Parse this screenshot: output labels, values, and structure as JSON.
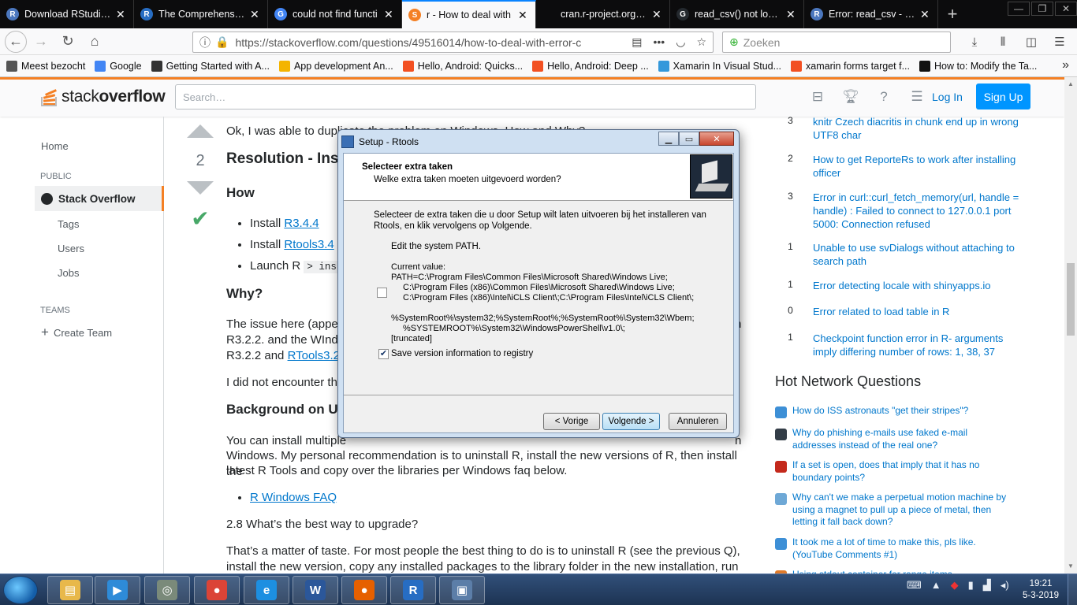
{
  "browser": {
    "tabs": [
      {
        "label": "Download RStudio -",
        "fav_color": "#4b77be",
        "fav_letter": "R"
      },
      {
        "label": "The Comprehensive",
        "fav_color": "#276dc3",
        "fav_letter": "R"
      },
      {
        "label": "could not find functi",
        "fav_color": "#4285f4",
        "fav_letter": "G"
      },
      {
        "label": "r - How to deal with",
        "fav_color": "#f48024",
        "fav_letter": "S"
      },
      {
        "label": "cran.r-project.org/bin/w",
        "fav_color": "",
        "fav_letter": ""
      },
      {
        "label": "read_csv() not loadin",
        "fav_color": "#24292e",
        "fav_letter": "G"
      },
      {
        "label": "Error: read_csv - RSt",
        "fav_color": "#4b77be",
        "fav_letter": "R"
      }
    ],
    "url": "https://stackoverflow.com/questions/49516014/how-to-deal-with-error-c",
    "search_placeholder": "Zoeken",
    "bookmarks": [
      {
        "label": "Meest bezocht",
        "icon": "gear-icon",
        "color": "#555"
      },
      {
        "label": "Google",
        "icon": "google-icon",
        "color": "#4285f4"
      },
      {
        "label": "Getting Started with A...",
        "icon": "cd-icon",
        "color": "#333"
      },
      {
        "label": "App development An...",
        "icon": "android-icon",
        "color": "#f4b400"
      },
      {
        "label": "Hello, Android: Quicks...",
        "icon": "microsoft-icon",
        "color": "#f25022"
      },
      {
        "label": "Hello, Android: Deep ...",
        "icon": "microsoft-icon",
        "color": "#f25022"
      },
      {
        "label": "Xamarin In Visual Stud...",
        "icon": "xamarin-icon",
        "color": "#3498db"
      },
      {
        "label": "xamarin forms target f...",
        "icon": "microsoft-icon",
        "color": "#f25022"
      },
      {
        "label": "How to: Modify the Ta...",
        "icon": "m-icon",
        "color": "#111"
      }
    ]
  },
  "so": {
    "logo_a": "stack",
    "logo_b": "overflow",
    "search_placeholder": "Search…",
    "login": "Log In",
    "signup": "Sign Up",
    "nav": {
      "home": "Home",
      "public": "PUBLIC",
      "stackoverflow": "Stack Overflow",
      "tags": "Tags",
      "users": "Users",
      "jobs": "Jobs",
      "teams": "TEAMS",
      "create_team": "Create Team"
    }
  },
  "answer": {
    "score": "2",
    "intro": "Ok, I was able to duplicate the problem on Windows. How and Why?",
    "resolution_heading": "Resolution - Ins",
    "how_heading": "How",
    "install_prefix_1": "Install ",
    "install_link_1": "R3.4.4",
    "install_prefix_2": "Install ",
    "install_link_2": "Rtools3.4",
    "launch": "Launch R ",
    "launch_code": "> ins",
    "why_heading": "Why?",
    "issue_text_1": "The issue here (appe",
    "issue_text_1b": "n",
    "issue_text_2": "R3.2.2. and the WInd",
    "issue_text_3a": "R3.2.2 and ",
    "issue_link_3": "RTools3.2",
    "encounter": "I did not encounter the",
    "background_heading": "Background on U",
    "install_multiple_a": "You can install multiple",
    "install_multiple_b": "n",
    "install_multiple_2": "Windows. My personal recommendation is to uninstall R, install the new versions of R, then install the",
    "install_multiple_3": "latest R Tools and copy over the libraries per Windows faq below.",
    "faq_link": "R Windows FAQ",
    "upgrade": "2.8 What’s the best way to upgrade?",
    "taste_1": "That’s a matter of taste. For most people the best thing to do is to uninstall R (see the previous Q),",
    "taste_2": "install the new version, copy any installed packages to the library folder in the new installation, run"
  },
  "related": [
    {
      "count": "3",
      "title": "knitr Czech diacritis in chunk end up in wrong UTF8 char"
    },
    {
      "count": "2",
      "title": "How to get ReporteRs to work after installing officer"
    },
    {
      "count": "3",
      "title": "Error in curl::curl_fetch_memory(url, handle = handle) : Failed to connect to 127.0.0.1 port 5000: Connection refused"
    },
    {
      "count": "1",
      "title": "Unable to use svDialogs without attaching to search path"
    },
    {
      "count": "1",
      "title": "Error detecting locale with shinyapps.io"
    },
    {
      "count": "0",
      "title": "Error related to load table in R"
    },
    {
      "count": "1",
      "title": "Checkpoint function error in R- arguments imply differing number of rows: 1, 38, 37"
    }
  ],
  "hnq": {
    "title": "Hot Network Questions",
    "items": [
      {
        "title": "How do ISS astronauts \"get their stripes\"?",
        "color": "#3d8fd6",
        "icon": "space-icon"
      },
      {
        "title": "Why do phishing e-mails use faked e-mail addresses instead of the real one?",
        "color": "#333d47",
        "icon": "security-icon"
      },
      {
        "title": "If a set is open, does that imply that it has no boundary points?",
        "color": "#c4291c",
        "icon": "math-icon"
      },
      {
        "title": "Why can't we make a perpetual motion machine by using a magnet to pull up a piece of metal, then letting it fall back down?",
        "color": "#6ea8d6",
        "icon": "physics-icon"
      },
      {
        "title": "It took me a lot of time to make this, pls like. (YouTube Comments #1)",
        "color": "#3d8fd6",
        "icon": "puzzling-icon"
      },
      {
        "title": "Using stdout container for range items",
        "color": "#e07b2a",
        "icon": "code-icon"
      }
    ]
  },
  "dialog": {
    "title": "Setup - Rtools",
    "heading": "Selecteer extra taken",
    "subheading": "Welke extra taken moeten uitgevoerd worden?",
    "instructions_1": "Selecteer de extra taken die u door Setup wilt laten uitvoeren bij het installeren van",
    "instructions_2": "Rtools, en klik vervolgens op Volgende.",
    "edit_path": "Edit the system PATH.",
    "current_value": "Current value:",
    "path_1": "PATH=C:\\Program Files\\Common Files\\Microsoft Shared\\Windows Live;",
    "path_2": "C:\\Program Files (x86)\\Common Files\\Microsoft Shared\\Windows Live;",
    "path_3": "C:\\Program Files (x86)\\Intel\\iCLS Client\\;C:\\Program Files\\Intel\\iCLS Client\\;",
    "path_4": "%SystemRoot%\\system32;%SystemRoot%;%SystemRoot%\\System32\\Wbem;",
    "path_5": "%SYSTEMROOT%\\System32\\WindowsPowerShell\\v1.0\\;",
    "path_6": "[truncated]",
    "save_version": "Save version information to registry",
    "path_checked": false,
    "save_checked": true,
    "back": "< Vorige",
    "next": "Volgende >",
    "cancel": "Annuleren"
  },
  "taskbar": {
    "time": "19:21",
    "date": "5-3-2019",
    "items": [
      {
        "name": "explorer",
        "color": "#e8b84a",
        "glyph": "▤"
      },
      {
        "name": "media-player",
        "color": "#2e8bd8",
        "glyph": "▶"
      },
      {
        "name": "disk-tool",
        "color": "#7a8a7a",
        "glyph": "◎"
      },
      {
        "name": "chrome",
        "color": "#db4437",
        "glyph": "●"
      },
      {
        "name": "internet-explorer",
        "color": "#1d8fe1",
        "glyph": "e"
      },
      {
        "name": "word",
        "color": "#2b579a",
        "glyph": "W"
      },
      {
        "name": "firefox",
        "color": "#e66000",
        "glyph": "●"
      },
      {
        "name": "r",
        "color": "#276dc3",
        "glyph": "R"
      },
      {
        "name": "setup",
        "color": "#5c7ea8",
        "glyph": "▣"
      }
    ]
  }
}
